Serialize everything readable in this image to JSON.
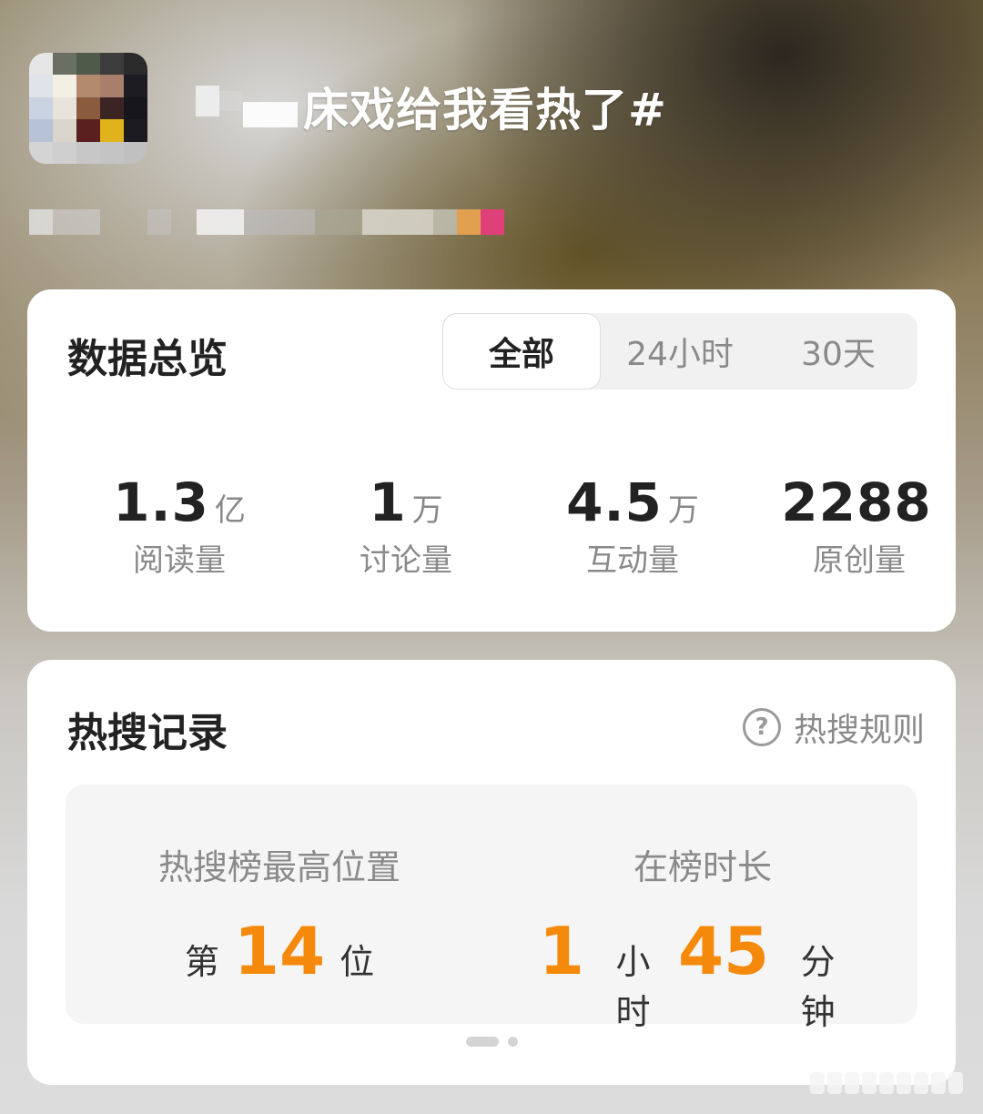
{
  "topic": {
    "title": "床戏给我看热了#"
  },
  "overview": {
    "title": "数据总览",
    "tabs": [
      {
        "label": "全部",
        "active": true
      },
      {
        "label": "24小时",
        "active": false
      },
      {
        "label": "30天",
        "active": false
      }
    ],
    "stats": [
      {
        "value": "1.3",
        "unit": "亿",
        "label": "阅读量"
      },
      {
        "value": "1",
        "unit": "万",
        "label": "讨论量"
      },
      {
        "value": "4.5",
        "unit": "万",
        "label": "互动量"
      },
      {
        "value": "2288",
        "unit": "",
        "label": "原创量"
      }
    ]
  },
  "hot_search": {
    "title": "热搜记录",
    "rules_label": "热搜规则",
    "highest": {
      "label": "热搜榜最高位置",
      "prefix": "第",
      "value": "14",
      "suffix": "位"
    },
    "duration": {
      "label": "在榜时长",
      "hours": "1",
      "hours_unit": "小时",
      "minutes": "45",
      "minutes_unit": "分钟"
    }
  },
  "colors": {
    "accent": "#f5890c",
    "card": "#ffffff"
  }
}
